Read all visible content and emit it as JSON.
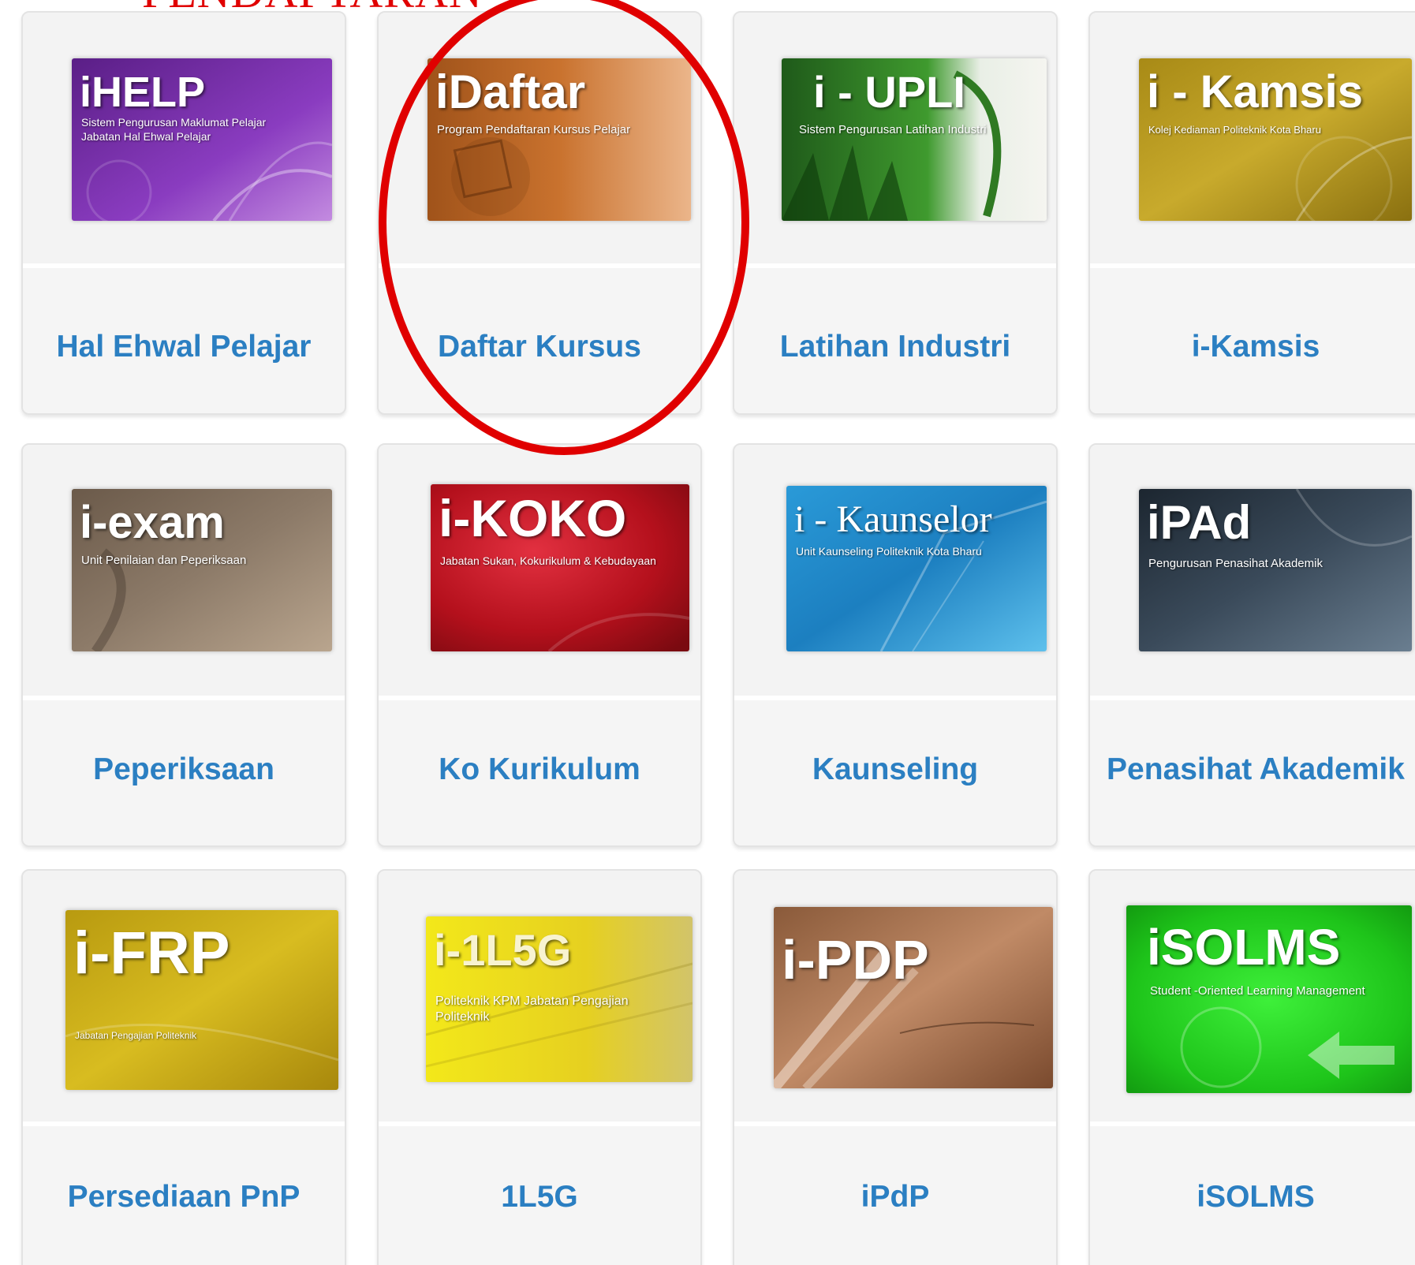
{
  "heading": "PENDAFTARAN",
  "colors": {
    "label": "#2b7fc2",
    "highlight": "#e00000"
  },
  "tiles": [
    {
      "label": "Hal Ehwal Pelajar",
      "banner": {
        "title": "iHELP",
        "subtitle": "Sistem Pengurusan Maklumat Pelajar Jabatan Hal Ehwal Pelajar",
        "icon": "ihelp-banner"
      }
    },
    {
      "label": "Daftar Kursus",
      "banner": {
        "title": "iDaftar",
        "subtitle": "Program Pendaftaran Kursus Pelajar",
        "icon": "idaftar-banner"
      }
    },
    {
      "label": "Latihan Industri",
      "banner": {
        "title": "i - UPLI",
        "subtitle": "Sistem Pengurusan Latihan Industri",
        "icon": "iupli-banner"
      }
    },
    {
      "label": "i-Kamsis",
      "banner": {
        "title": "i - Kamsis",
        "subtitle": "Kolej Kediaman Politeknik Kota Bharu",
        "icon": "ikamsis-banner"
      }
    },
    {
      "label": "Peperiksaan",
      "banner": {
        "title": "i-exam",
        "subtitle": "Unit Penilaian dan Peperiksaan",
        "icon": "iexam-banner"
      }
    },
    {
      "label": "Ko Kurikulum",
      "banner": {
        "title": "i-KOKO",
        "subtitle": "Jabatan Sukan, Kokurikulum & Kebudayaan",
        "icon": "ikoko-banner"
      }
    },
    {
      "label": "Kaunseling",
      "banner": {
        "title": "i - Kaunselor",
        "subtitle": "Unit Kaunseling Politeknik Kota Bharu",
        "icon": "ikaunselor-banner"
      }
    },
    {
      "label": "Penasihat Akademik",
      "banner": {
        "title": "iPAd",
        "subtitle": "Pengurusan Penasihat Akademik",
        "icon": "ipad-banner"
      }
    },
    {
      "label": "Persediaan PnP",
      "banner": {
        "title": "i-FRP",
        "subtitle": "Jabatan Pengajian Politeknik",
        "icon": "ifrp-banner"
      }
    },
    {
      "label": "1L5G",
      "banner": {
        "title": "i-1L5G",
        "subtitle": "Politeknik KPM Jabatan Pengajian Politeknik",
        "icon": "i1l5g-banner"
      }
    },
    {
      "label": "iPdP",
      "banner": {
        "title": "i-PDP",
        "subtitle": "",
        "icon": "ipdp-banner"
      }
    },
    {
      "label": "iSOLMS",
      "banner": {
        "title": "iSOLMS",
        "subtitle": "Student -Oriented Learning Management",
        "icon": "isolms-banner"
      }
    }
  ]
}
